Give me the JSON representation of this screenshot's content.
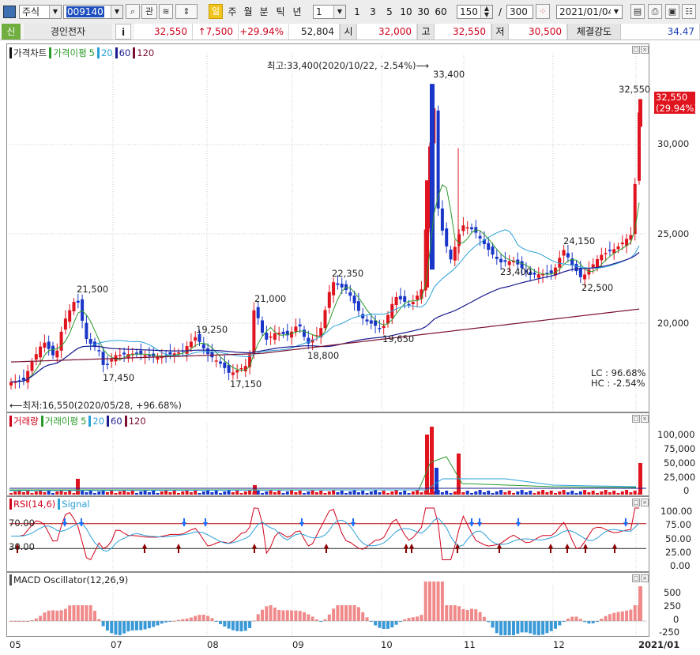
{
  "toolbar": {
    "market": "주식",
    "code": "009140",
    "btn_chart": "관",
    "tag_day": "일",
    "periods": [
      "주",
      "월",
      "분",
      "틱",
      "년"
    ],
    "interval_value": "1",
    "quick_intervals": [
      "1",
      "3",
      "5",
      "10",
      "30",
      "60"
    ],
    "count_value": "150",
    "slash": "/",
    "total_value": "300",
    "date_value": "2021/01/04"
  },
  "quote": {
    "badge": "신",
    "name": "경인전자",
    "info_btn": "i",
    "price": "32,550",
    "change": "↑7,500",
    "change_pct": "+29.94%",
    "volume": "52,804",
    "open_label": "시",
    "open": "32,000",
    "high_label": "고",
    "high": "32,550",
    "low_label": "저",
    "low": "30,500",
    "strength_label": "체결강도",
    "strength": "34.47"
  },
  "price_pane": {
    "legend": {
      "title": "가격차트",
      "ma_label": "가격이평",
      "ma5": "5",
      "ma20": "20",
      "ma60": "60",
      "ma120": "120"
    },
    "high_annotation": "최고:33,400(2020/10/22, -2.54%)⟶",
    "low_annotation": "⟵최저:16,550(2020/05/28, +96.68%)",
    "lc": "LC :  96.68%",
    "hc": "HC :  -2.54%",
    "last_price_box": "32,550",
    "last_pct_box": "(29.94%)",
    "y_ticks": [
      "30,000",
      "25,000",
      "20,000"
    ],
    "point_labels": [
      "21,500",
      "17,450",
      "19,250",
      "17,150",
      "21,000",
      "18,800",
      "22,350",
      "19,650",
      "33,400",
      "23,400",
      "24,150",
      "22,500",
      "32,550"
    ]
  },
  "volume_pane": {
    "legend": {
      "title": "거래량",
      "ma_label": "거래이평",
      "ma5": "5",
      "ma20": "20",
      "ma60": "60",
      "ma120": "120"
    },
    "y_ticks": [
      "100,000",
      "75,000",
      "50,000",
      "25,000",
      "0"
    ]
  },
  "rsi_pane": {
    "legend": {
      "title": "RSI(14,6)",
      "signal": "Signal"
    },
    "line_high": "70.00",
    "line_low": "30.00",
    "y_ticks": [
      "100.00",
      "75.00",
      "50.00",
      "25.00",
      "0.00"
    ]
  },
  "macd_pane": {
    "legend": "MACD Oscillator(12,26,9)",
    "y_ticks": [
      "500",
      "250",
      "0",
      "-250"
    ]
  },
  "x_axis": [
    "05",
    "07",
    "08",
    "09",
    "10",
    "11",
    "12",
    "2021/01"
  ],
  "colors": {
    "up": "#e0141e",
    "down": "#1a36c9",
    "ma5": "#2a9a2a",
    "ma20": "#2aa0d8",
    "ma60": "#1c1c8f",
    "ma120": "#7a1030"
  }
}
